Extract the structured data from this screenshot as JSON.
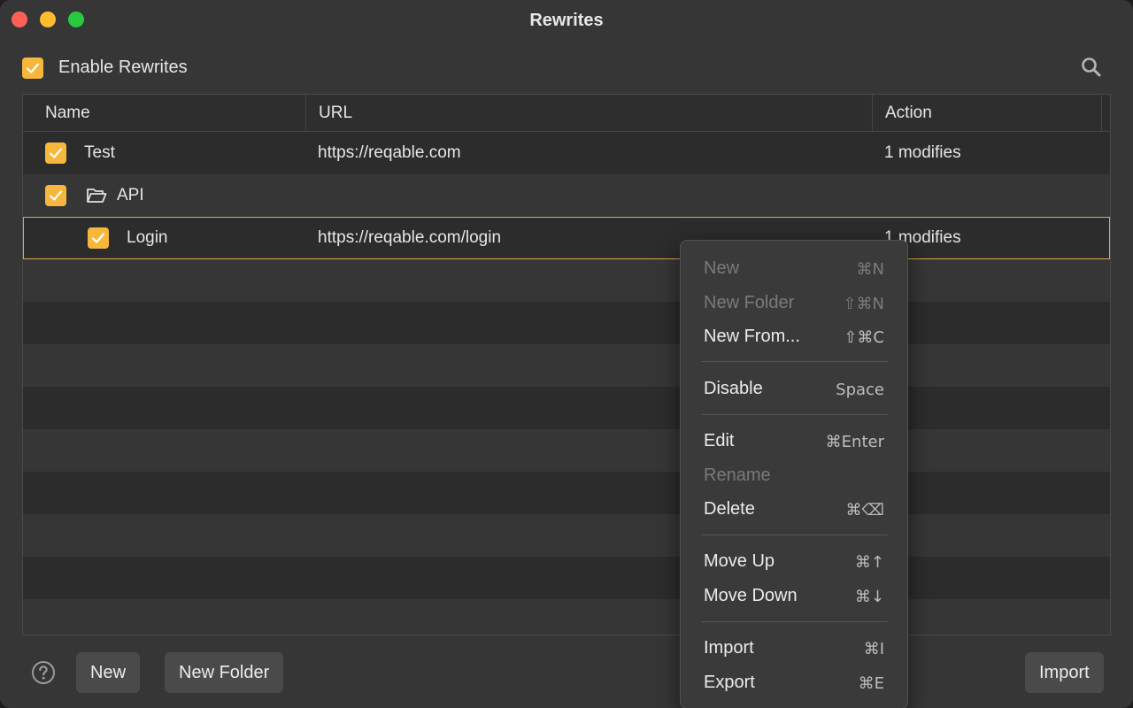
{
  "window": {
    "title": "Rewrites"
  },
  "toolbar": {
    "enable_label": "Enable Rewrites",
    "enable_checked": true,
    "search_icon": "search-icon"
  },
  "table": {
    "columns": [
      "Name",
      "URL",
      "Action"
    ],
    "rows": [
      {
        "name": "Test",
        "url": "https://reqable.com",
        "action": "1 modifies",
        "checked": true,
        "type": "rule"
      },
      {
        "name": "API",
        "url": "",
        "action": "",
        "checked": true,
        "type": "folder"
      },
      {
        "name": "Login",
        "url": "https://reqable.com/login",
        "action": "1 modifies",
        "checked": true,
        "type": "rule",
        "selected": true
      }
    ]
  },
  "footer": {
    "help_icon": "help-icon",
    "new_label": "New",
    "new_folder_label": "New Folder",
    "import_label": "Import"
  },
  "context_menu": {
    "items": [
      {
        "label": "New",
        "shortcut": "⌘N",
        "enabled": false
      },
      {
        "label": "New Folder",
        "shortcut": "⇧⌘N",
        "enabled": false
      },
      {
        "label": "New From...",
        "shortcut": "⇧⌘C",
        "enabled": true
      },
      {
        "label": "Disable",
        "shortcut": "Space",
        "enabled": true
      },
      {
        "label": "Edit",
        "shortcut": "⌘Enter",
        "enabled": true
      },
      {
        "label": "Rename",
        "shortcut": "",
        "enabled": false
      },
      {
        "label": "Delete",
        "shortcut": "⌘⌫",
        "enabled": true
      },
      {
        "label": "Move Up",
        "shortcut": "⌘↑",
        "enabled": true
      },
      {
        "label": "Move Down",
        "shortcut": "⌘↓",
        "enabled": true
      },
      {
        "label": "Import",
        "shortcut": "⌘I",
        "enabled": true
      },
      {
        "label": "Export",
        "shortcut": "⌘E",
        "enabled": true
      }
    ]
  },
  "colors": {
    "accent": "#f6b73c",
    "selection_border": "#e3a843",
    "background": "#363636"
  }
}
